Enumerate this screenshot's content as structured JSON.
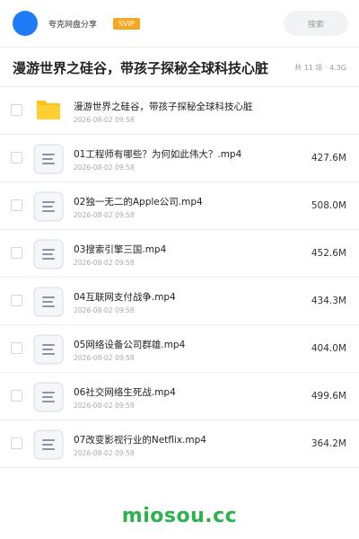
{
  "header": {
    "app_name": "夸克网盘分享",
    "badge": "SVIP",
    "search_label": "搜索",
    "accent_color": "#1e7cf6",
    "badge_color": "#f6a623"
  },
  "share": {
    "title": "漫游世界之硅谷，带孩子探秘全球科技心脏",
    "meta": "共 11 项 · 4.3G"
  },
  "items": [
    {
      "name": "漫游世界之硅谷，带孩子探秘全球科技心脏",
      "date": "2026-08-02 09:58",
      "size": "",
      "icon": "folder-icon"
    },
    {
      "name": "01工程师有哪些？为何如此伟大？.mp4",
      "date": "2026-08-02 09:58",
      "size": "427.6M",
      "icon": "video-file-icon"
    },
    {
      "name": "02独一无二的Apple公司.mp4",
      "date": "2026-08-02 09:58",
      "size": "508.0M",
      "icon": "video-file-icon"
    },
    {
      "name": "03搜索引擎三国.mp4",
      "date": "2026-08-02 09:58",
      "size": "452.6M",
      "icon": "video-file-icon"
    },
    {
      "name": "04互联网支付战争.mp4",
      "date": "2026-08-02 09:58",
      "size": "434.3M",
      "icon": "video-file-icon"
    },
    {
      "name": "05网络设备公司群雄.mp4",
      "date": "2026-08-02 09:58",
      "size": "404.0M",
      "icon": "video-file-icon"
    },
    {
      "name": "06社交网络生死战.mp4",
      "date": "2026-08-02 09:58",
      "size": "499.6M",
      "icon": "video-file-icon"
    },
    {
      "name": "07改变影视行业的Netflix.mp4",
      "date": "2026-08-02 09:58",
      "size": "364.2M",
      "icon": "video-file-icon"
    }
  ],
  "footer": {
    "brand": "miosou.cc",
    "brand_color": "#2bb24c"
  }
}
